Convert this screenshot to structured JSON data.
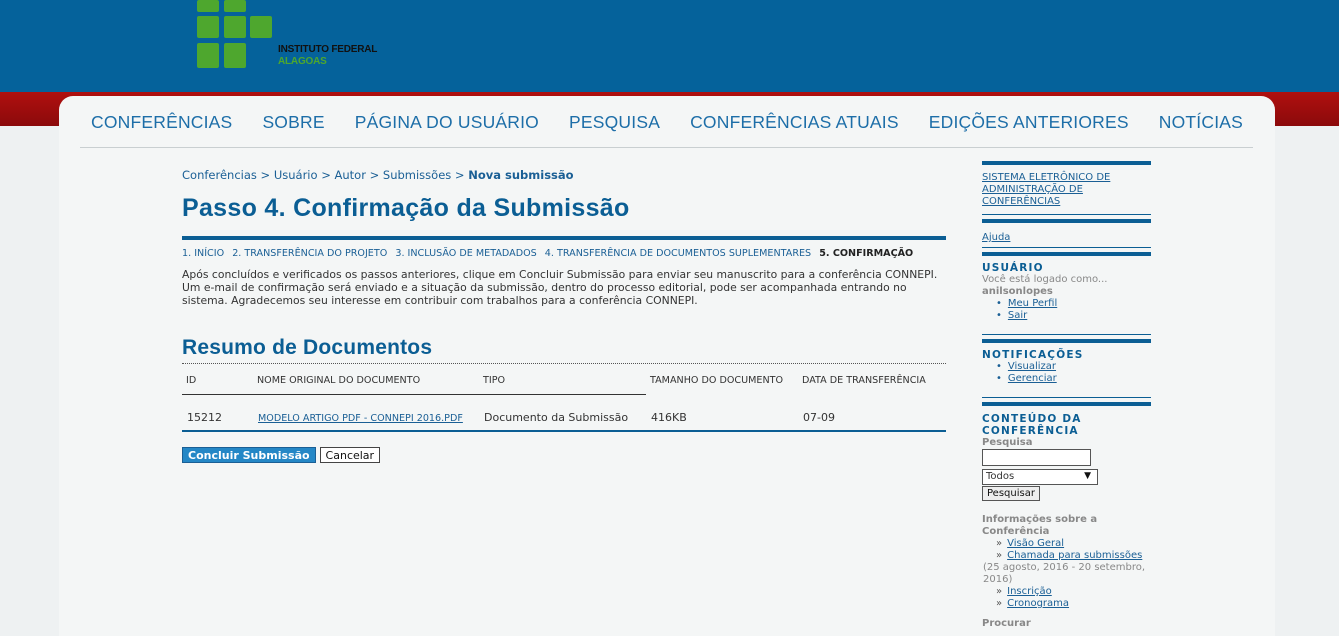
{
  "logo": {
    "line1": "INSTITUTO FEDERAL",
    "line2": "ALAGOAS",
    "brand_green": "#4ea72e"
  },
  "colors": {
    "header_blue": "#05629b",
    "accent_red": "#a40d10",
    "link_blue": "#1a5f95"
  },
  "nav": [
    "CONFERÊNCIAS",
    "SOBRE",
    "PÁGINA DO USUÁRIO",
    "PESQUISA",
    "CONFERÊNCIAS ATUAIS",
    "EDIÇÕES ANTERIORES",
    "NOTÍCIAS"
  ],
  "breadcrumb": {
    "items": [
      "Conferências",
      "Usuário",
      "Autor",
      "Submissões"
    ],
    "current": "Nova submissão",
    "sep": ">"
  },
  "title": "Passo 4. Confirmação da Submissão",
  "steps": [
    "1. INÍCIO",
    "2. TRANSFERÊNCIA DO PROJETO",
    "3. INCLUSÃO DE METADADOS",
    "4. TRANSFERÊNCIA DE DOCUMENTOS SUPLEMENTARES",
    "5. CONFIRMAÇÃO"
  ],
  "intro": "Após concluídos e verificados os passos anteriores, clique em Concluir Submissão para enviar seu manuscrito para a conferência CONNEPI. Um e-mail de confirmação será enviado e a situação da submissão, dentro do processo editorial, pode ser acompanhada entrando no sistema. Agradecemos seu interesse em contribuir com trabalhos para a conferência CONNEPI.",
  "summary": {
    "title": "Resumo de Documentos",
    "columns": [
      "ID",
      "NOME ORIGINAL DO DOCUMENTO",
      "TIPO",
      "TAMANHO DO DOCUMENTO",
      "DATA DE TRANSFERÊNCIA"
    ],
    "rows": [
      {
        "id": "15212",
        "name": "MODELO ARTIGO PDF - CONNEPI 2016.PDF",
        "type": "Documento da Submissão",
        "size": "416KB",
        "date": "07-09"
      }
    ]
  },
  "buttons": {
    "submit": "Concluir Submissão",
    "cancel": "Cancelar"
  },
  "sidebar": {
    "system_link": "SISTEMA ELETRÔNICO DE ADMINISTRAÇÃO DE CONFERÊNCIAS",
    "help": "Ajuda",
    "user": {
      "title": "USUÁRIO",
      "logged_as": "Você está logado como...",
      "username": "anilsonlopes",
      "links": [
        "Meu Perfil",
        "Sair"
      ]
    },
    "notifications": {
      "title": "NOTIFICAÇÕES",
      "links": [
        "Visualizar",
        "Gerenciar"
      ]
    },
    "content": {
      "title": "CONTEÚDO DA CONFERÊNCIA",
      "search_label": "Pesquisa",
      "search_value": "",
      "select_value": "Todos",
      "search_button": "Pesquisar",
      "info_title": "Informações sobre a Conferência",
      "info_links": [
        "Visão Geral",
        "Chamada para submissões",
        "Inscrição",
        "Cronograma"
      ],
      "call_dates": "(25 agosto, 2016 - 20 setembro, 2016)",
      "more": "Procurar"
    }
  }
}
